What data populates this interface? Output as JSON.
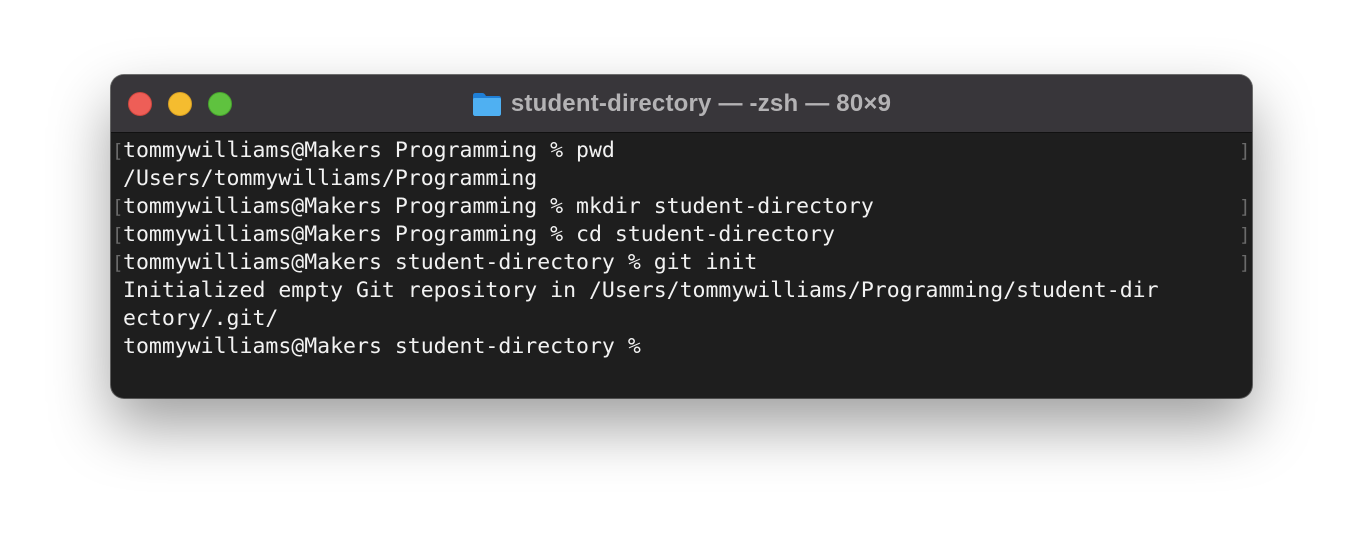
{
  "window": {
    "title": "student-directory — -zsh — 80×9",
    "folder_icon": "folder-icon",
    "controls": [
      "close-button",
      "minimize-button",
      "maximize-button"
    ]
  },
  "terminal": {
    "mark_open": "[",
    "mark_close": "]",
    "lines": [
      {
        "text": "tommywilliams@Makers Programming % pwd",
        "marked": true
      },
      {
        "text": "/Users/tommywilliams/Programming",
        "marked": false
      },
      {
        "text": "tommywilliams@Makers Programming % mkdir student-directory",
        "marked": true
      },
      {
        "text": "tommywilliams@Makers Programming % cd student-directory",
        "marked": true
      },
      {
        "text": "tommywilliams@Makers student-directory % git init",
        "marked": true
      },
      {
        "text": "Initialized empty Git repository in /Users/tommywilliams/Programming/student-dir",
        "marked": false
      },
      {
        "text": "ectory/.git/",
        "marked": false
      },
      {
        "text": "tommywilliams@Makers student-directory % ",
        "marked": false
      }
    ]
  },
  "colors": {
    "close": "#ee5e57",
    "minimize": "#f5bc2f",
    "maximize": "#5fc23f",
    "terminal_bg": "#1e1e1e",
    "text": "#f2f2f2"
  }
}
